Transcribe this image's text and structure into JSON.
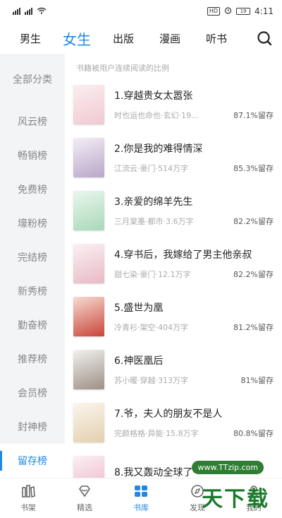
{
  "status": {
    "time": "4:11",
    "battery": "19",
    "hd": "HD"
  },
  "topnav": {
    "tabs": [
      "男生",
      "女生",
      "出版",
      "漫画",
      "听书"
    ],
    "active": 1
  },
  "sidebar": {
    "items": [
      "全部分类",
      "风云榜",
      "畅销榜",
      "免费榜",
      "壕粉榜",
      "完结榜",
      "新秀榜",
      "勤奋榜",
      "推荐榜",
      "会员榜",
      "封神榜",
      "留存榜"
    ],
    "active": 11
  },
  "main": {
    "subtitle": "书籍被用户连续阅读的比例",
    "books": [
      {
        "title": "1.穿越贵女太嚣张",
        "meta": "时也运也命也·玄幻·19...",
        "rate": "87.1%留存",
        "cover_color": "#f6e3e6"
      },
      {
        "title": "2.你是我的难得情深",
        "meta": "江流云·豪门·514万字",
        "rate": "85.3%留存",
        "cover_color": "#efe6f2"
      },
      {
        "title": "3.亲爱的绵羊先生",
        "meta": "三月棠墨·都市·3.6万字",
        "rate": "82.2%留存",
        "cover_color": "#e3f1e8"
      },
      {
        "title": "4.穿书后，我嫁给了男主他亲叔",
        "meta": "甜七染·豪门·12.1万字",
        "rate": "82.2%留存",
        "cover_color": "#f6e6ea"
      },
      {
        "title": "5.盛世为凰",
        "meta": "冷青衫·架空·404万字",
        "rate": "81.2%留存",
        "cover_color": "#f3d7cf"
      },
      {
        "title": "6.神医凰后",
        "meta": "苏小暖·穿越·313万字",
        "rate": "81%留存",
        "cover_color": "#ece9e5"
      },
      {
        "title": "7.爷，夫人的朋友不是人",
        "meta": "完颜格格·异能·15.8万字",
        "rate": "80.8%留存",
        "cover_color": "#f5efe6"
      },
      {
        "title": "8.我又轰动全球了",
        "meta": "",
        "rate": "",
        "cover_color": "#f5e3ea"
      }
    ]
  },
  "bottomnav": {
    "items": [
      "书架",
      "精选",
      "书库",
      "发现",
      "我的"
    ],
    "active": 2
  },
  "watermark": {
    "url": "www.TTzip.com",
    "text": "天下载"
  }
}
